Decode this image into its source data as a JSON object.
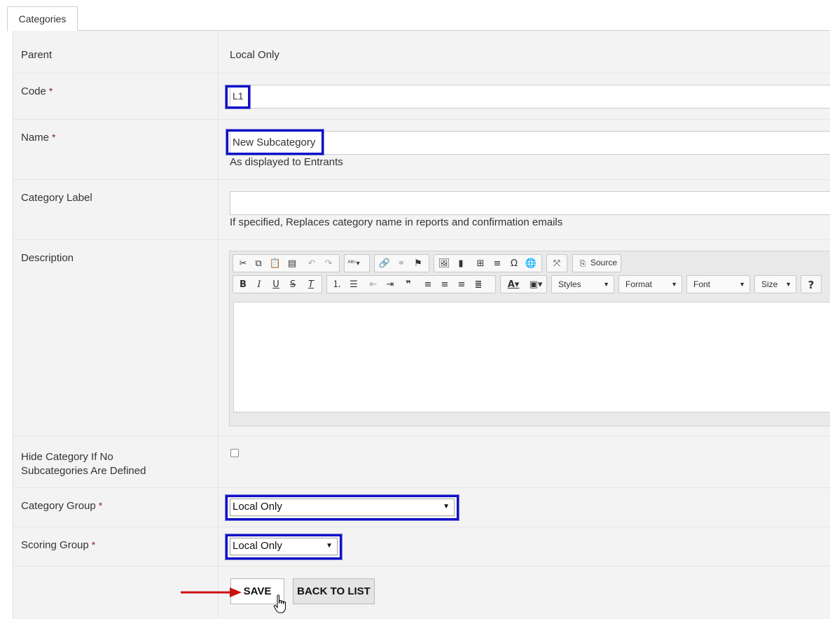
{
  "tabs": [
    {
      "label": "Categories"
    }
  ],
  "form": {
    "parent": {
      "label": "Parent",
      "value": "Local Only"
    },
    "code": {
      "label": "Code",
      "required_mark": "*",
      "value": "L1"
    },
    "name": {
      "label": "Name",
      "required_mark": "*",
      "value": "New Subcategory",
      "help": "As displayed to Entrants"
    },
    "category_label": {
      "label": "Category Label",
      "value": "",
      "help": "If specified, Replaces category name in reports and confirmation emails"
    },
    "description": {
      "label": "Description",
      "toolbar": {
        "source_label": "Source",
        "styles_label": "Styles",
        "format_label": "Format",
        "font_label": "Font",
        "size_label": "Size",
        "help_label": "?"
      }
    },
    "hide_category": {
      "label_line1": "Hide Category If No",
      "label_line2": "Subcategories Are Defined",
      "checked": false
    },
    "category_group": {
      "label": "Category Group",
      "required_mark": "*",
      "value": "Local Only"
    },
    "scoring_group": {
      "label": "Scoring Group",
      "required_mark": "*",
      "value": "Local Only"
    }
  },
  "actions": {
    "save_label": "SAVE",
    "back_label": "BACK TO LIST"
  },
  "colors": {
    "highlight": "#1010c8",
    "required": "#8a1f1f",
    "arrow": "#cc1010"
  }
}
